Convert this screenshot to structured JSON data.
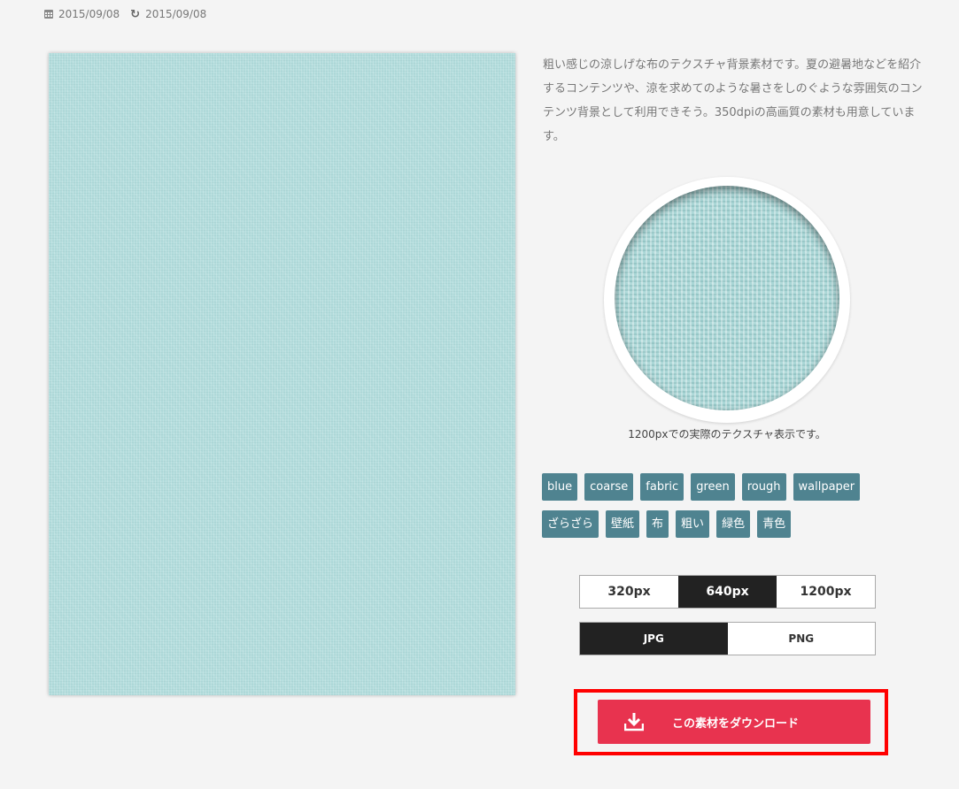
{
  "meta": {
    "published_date": "2015/09/08",
    "updated_date": "2015/09/08"
  },
  "description": "粗い感じの涼しげな布のテクスチャ背景素材です。夏の避暑地などを紹介するコンテンツや、涼を求めてのような暑さをしのぐような雰囲気のコンテンツ背景として利用できそう。350dpiの高画質の素材も用意しています。",
  "zoom_caption": "1200pxでの実際のテクスチャ表示です。",
  "tags_row1": [
    "blue",
    "coarse",
    "fabric",
    "green",
    "rough",
    "wallpaper"
  ],
  "tags_row2": [
    "ざらざら",
    "壁紙",
    "布",
    "粗い",
    "緑色",
    "青色"
  ],
  "sizes": [
    {
      "label": "320px",
      "selected": false
    },
    {
      "label": "640px",
      "selected": true
    },
    {
      "label": "1200px",
      "selected": false
    }
  ],
  "formats": [
    {
      "label": "JPG",
      "selected": true
    },
    {
      "label": "PNG",
      "selected": false
    }
  ],
  "download_label": "この素材をダウンロード",
  "colors": {
    "tag_bg": "#4f8390",
    "download_bg": "#e8334f",
    "highlight": "#ff0000",
    "texture": "#b2dcdc"
  }
}
